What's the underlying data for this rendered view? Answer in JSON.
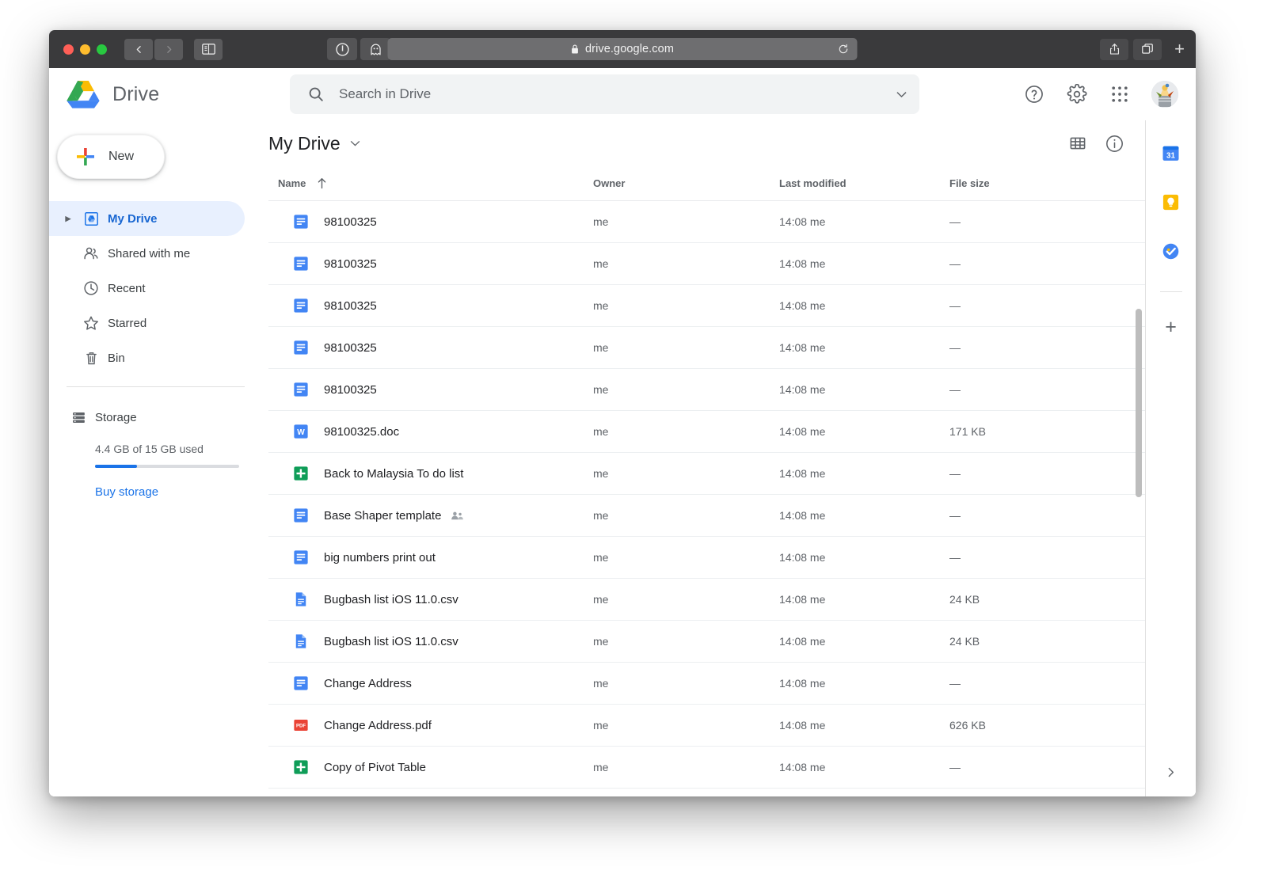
{
  "browser": {
    "url": "drive.google.com",
    "lock_icon": "lock-icon",
    "reload_icon": "reload-icon",
    "back_icon": "back-arrow-icon",
    "forward_icon": "forward-arrow-icon",
    "sidebar_icon": "sidebar-toggle-icon",
    "extensions": [
      "onepassword-icon",
      "ghostery-icon",
      "vimium-icon"
    ],
    "share_icon": "share-icon",
    "tabs_icon": "show-tabs-icon",
    "new_tab_icon": "new-tab-plus-icon"
  },
  "header": {
    "product_name": "Drive",
    "logo_icon": "google-drive-logo",
    "search": {
      "placeholder": "Search in Drive",
      "value": "",
      "search_icon": "search-icon",
      "options_icon": "chevron-down-icon"
    },
    "help_icon": "help-circle-icon",
    "settings_icon": "gear-icon",
    "apps_icon": "apps-grid-icon",
    "avatar_icon": "user-avatar"
  },
  "sidebar": {
    "new_button": {
      "label": "New",
      "icon": "plus-icon"
    },
    "items": [
      {
        "label": "My Drive",
        "icon": "my-drive-icon",
        "active": true,
        "expandable": true
      },
      {
        "label": "Shared with me",
        "icon": "people-icon",
        "active": false,
        "expandable": false
      },
      {
        "label": "Recent",
        "icon": "clock-icon",
        "active": false,
        "expandable": false
      },
      {
        "label": "Starred",
        "icon": "star-icon",
        "active": false,
        "expandable": false
      },
      {
        "label": "Bin",
        "icon": "trash-icon",
        "active": false,
        "expandable": false
      }
    ],
    "storage": {
      "label": "Storage",
      "icon": "storage-icon",
      "used_text": "4.4 GB of 15 GB used",
      "percent": 29,
      "buy_label": "Buy storage",
      "accent_color": "#1a73e8"
    }
  },
  "main": {
    "breadcrumb": "My Drive",
    "breadcrumb_caret": "chevron-down-icon",
    "grid_view_icon": "grid-view-icon",
    "details_icon": "info-circle-icon",
    "columns": {
      "name": "Name",
      "owner": "Owner",
      "modified": "Last modified",
      "size": "File size",
      "sort_icon": "sort-ascending-arrow"
    },
    "rows": [
      {
        "name": "98100325",
        "icon": "google-docs-icon",
        "owner": "me",
        "modified": "14:08 me",
        "size": "—",
        "shared": false
      },
      {
        "name": "98100325",
        "icon": "google-docs-icon",
        "owner": "me",
        "modified": "14:08 me",
        "size": "—",
        "shared": false
      },
      {
        "name": "98100325",
        "icon": "google-docs-icon",
        "owner": "me",
        "modified": "14:08 me",
        "size": "—",
        "shared": false
      },
      {
        "name": "98100325",
        "icon": "google-docs-icon",
        "owner": "me",
        "modified": "14:08 me",
        "size": "—",
        "shared": false
      },
      {
        "name": "98100325",
        "icon": "google-docs-icon",
        "owner": "me",
        "modified": "14:08 me",
        "size": "—",
        "shared": false
      },
      {
        "name": "98100325.doc",
        "icon": "word-doc-icon",
        "owner": "me",
        "modified": "14:08 me",
        "size": "171 KB",
        "shared": false
      },
      {
        "name": "Back to Malaysia To do list",
        "icon": "google-sheets-icon",
        "owner": "me",
        "modified": "14:08 me",
        "size": "—",
        "shared": false
      },
      {
        "name": "Base Shaper template",
        "icon": "google-docs-icon",
        "owner": "me",
        "modified": "14:08 me",
        "size": "—",
        "shared": true
      },
      {
        "name": "big numbers print out",
        "icon": "google-docs-icon",
        "owner": "me",
        "modified": "14:08 me",
        "size": "—",
        "shared": false
      },
      {
        "name": "Bugbash list iOS 11.0.csv",
        "icon": "csv-file-icon",
        "owner": "me",
        "modified": "14:08 me",
        "size": "24 KB",
        "shared": false
      },
      {
        "name": "Bugbash list iOS 11.0.csv",
        "icon": "csv-file-icon",
        "owner": "me",
        "modified": "14:08 me",
        "size": "24 KB",
        "shared": false
      },
      {
        "name": "Change Address",
        "icon": "google-docs-icon",
        "owner": "me",
        "modified": "14:08 me",
        "size": "—",
        "shared": false
      },
      {
        "name": "Change Address.pdf",
        "icon": "pdf-file-icon",
        "owner": "me",
        "modified": "14:08 me",
        "size": "626 KB",
        "shared": false
      },
      {
        "name": "Copy of Pivot Table",
        "icon": "google-sheets-icon",
        "owner": "me",
        "modified": "14:08 me",
        "size": "—",
        "shared": false
      }
    ]
  },
  "side_panel": {
    "items": [
      "google-calendar-icon",
      "google-keep-icon",
      "google-tasks-icon"
    ],
    "add_icon": "plus-icon",
    "expand_icon": "chevron-right-icon"
  }
}
